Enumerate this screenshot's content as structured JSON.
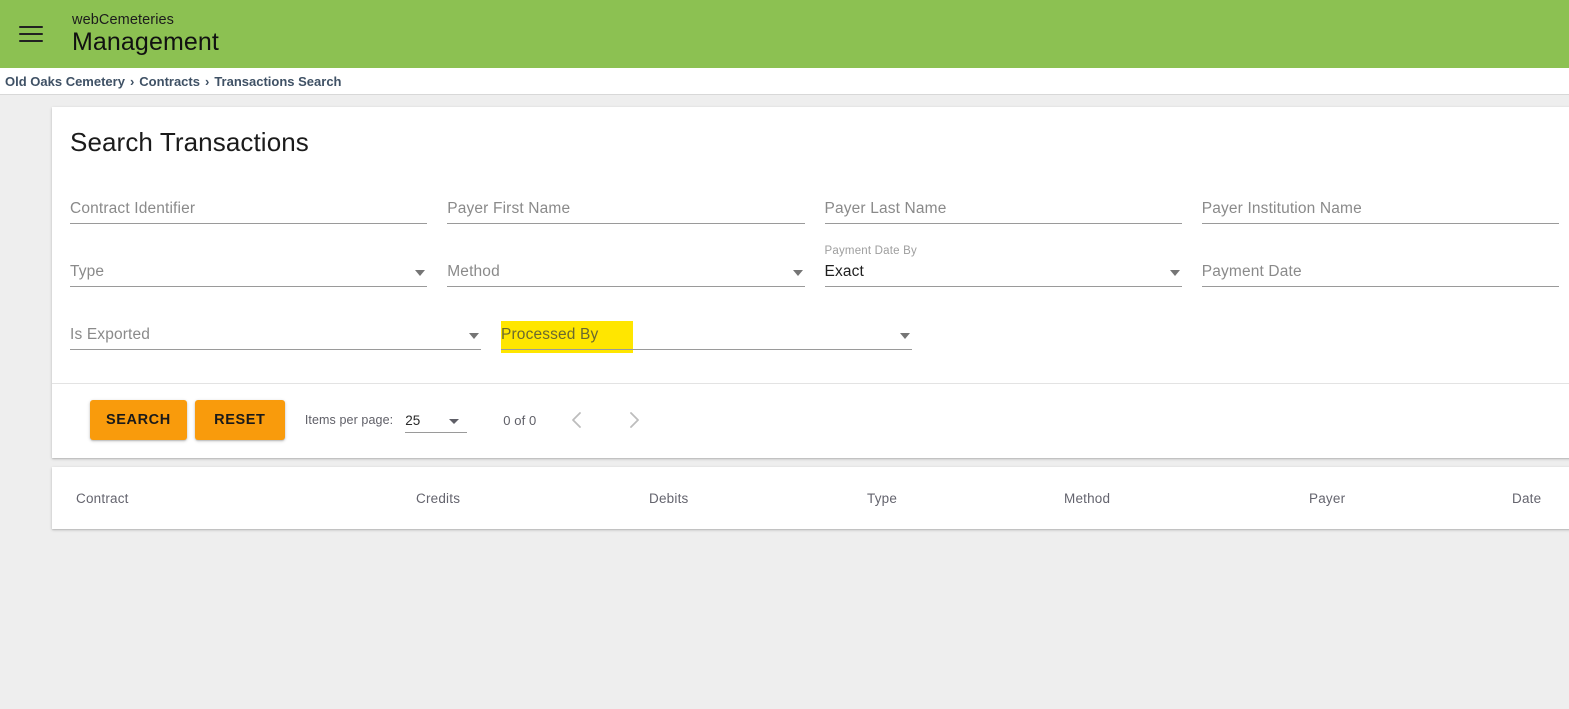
{
  "appbar": {
    "menu_icon": "hamburger-menu-icon",
    "brand_top": "webCemeteries",
    "brand_main": "Management",
    "background_color": "#8cc152"
  },
  "breadcrumb": {
    "separator": "›",
    "items": [
      {
        "label": "Old Oaks Cemetery"
      },
      {
        "label": "Contracts"
      },
      {
        "label": "Transactions Search"
      }
    ]
  },
  "search_card": {
    "title": "Search Transactions",
    "rows": [
      {
        "fields": [
          {
            "name": "contract-identifier",
            "placeholder": "Contract Identifier",
            "type": "text",
            "value": ""
          },
          {
            "name": "payer-first-name",
            "placeholder": "Payer First Name",
            "type": "text",
            "value": ""
          },
          {
            "name": "payer-last-name",
            "placeholder": "Payer Last Name",
            "type": "text",
            "value": ""
          },
          {
            "name": "payer-institution-name",
            "placeholder": "Payer Institution Name",
            "type": "text",
            "value": ""
          }
        ]
      },
      {
        "fields": [
          {
            "name": "type",
            "placeholder": "Type",
            "type": "select",
            "value": ""
          },
          {
            "name": "method",
            "placeholder": "Method",
            "type": "select",
            "value": ""
          },
          {
            "name": "payment-date-by",
            "label": "Payment Date By",
            "type": "select",
            "value": "Exact"
          },
          {
            "name": "payment-date",
            "placeholder": "Payment Date",
            "type": "text",
            "value": ""
          }
        ]
      },
      {
        "fields": [
          {
            "name": "is-exported",
            "placeholder": "Is Exported",
            "type": "select",
            "value": ""
          },
          {
            "name": "processed-by",
            "placeholder": "Processed By",
            "type": "select",
            "value": "",
            "highlight": true,
            "highlight_color": "#FFE600"
          }
        ]
      }
    ],
    "actions": {
      "search_label": "SEARCH",
      "reset_label": "RESET",
      "button_color": "#f99b0c"
    },
    "paginator": {
      "items_per_page_label": "Items per page:",
      "items_per_page_value": "25",
      "range_label": "0 of 0",
      "previous_icon": "chevron-left-icon",
      "next_icon": "chevron-right-icon"
    }
  },
  "results_table": {
    "columns": [
      {
        "label": "Contract"
      },
      {
        "label": "Credits"
      },
      {
        "label": "Debits"
      },
      {
        "label": "Type"
      },
      {
        "label": "Method"
      },
      {
        "label": "Payer"
      },
      {
        "label": "Date"
      }
    ],
    "rows": []
  }
}
